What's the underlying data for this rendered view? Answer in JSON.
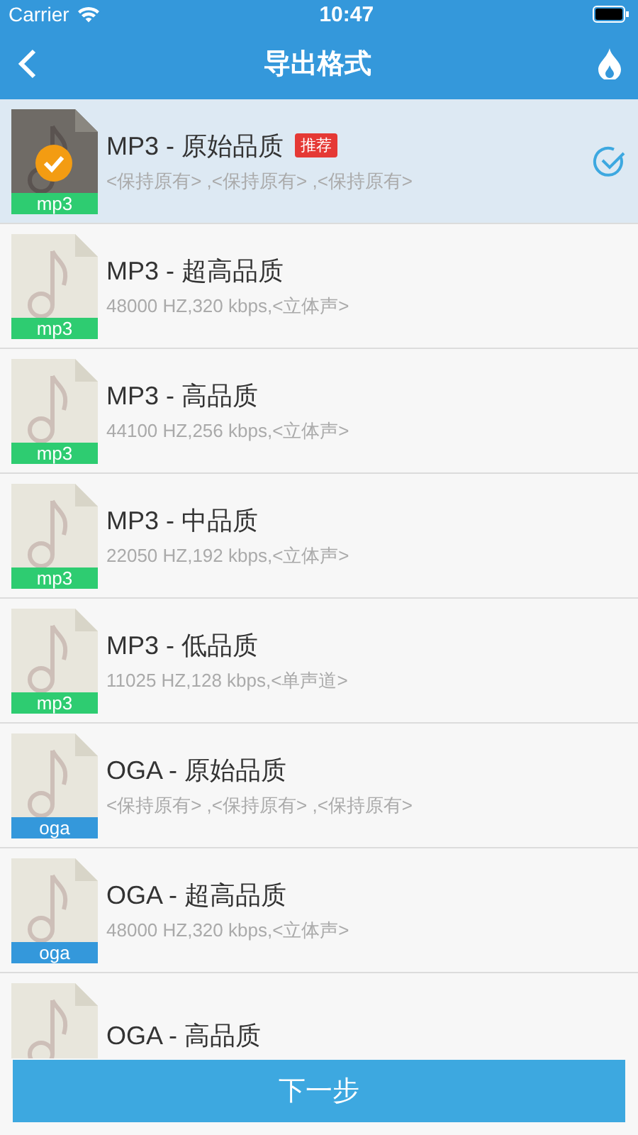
{
  "status_bar": {
    "carrier": "Carrier",
    "time": "10:47"
  },
  "nav": {
    "title": "导出格式"
  },
  "formats": [
    {
      "title": "MP3 - 原始品质",
      "detail": "<保持原有> ,<保持原有> ,<保持原有>",
      "tag": "mp3",
      "color": "#2ecc71",
      "badge": "推荐",
      "selected": true
    },
    {
      "title": "MP3 - 超高品质",
      "detail": "48000 HZ,320 kbps,<立体声>",
      "tag": "mp3",
      "color": "#2ecc71",
      "selected": false
    },
    {
      "title": "MP3 - 高品质",
      "detail": "44100 HZ,256 kbps,<立体声>",
      "tag": "mp3",
      "color": "#2ecc71",
      "selected": false
    },
    {
      "title": "MP3 - 中品质",
      "detail": "22050 HZ,192 kbps,<立体声>",
      "tag": "mp3",
      "color": "#2ecc71",
      "selected": false
    },
    {
      "title": "MP3 - 低品质",
      "detail": "11025 HZ,128 kbps,<单声道>",
      "tag": "mp3",
      "color": "#2ecc71",
      "selected": false
    },
    {
      "title": "OGA - 原始品质",
      "detail": "<保持原有> ,<保持原有> ,<保持原有>",
      "tag": "oga",
      "color": "#3498db",
      "selected": false
    },
    {
      "title": "OGA - 超高品质",
      "detail": "48000 HZ,320 kbps,<立体声>",
      "tag": "oga",
      "color": "#3498db",
      "selected": false
    },
    {
      "title": "OGA - 高品质",
      "selected": false
    }
  ],
  "next_button": "下一步"
}
